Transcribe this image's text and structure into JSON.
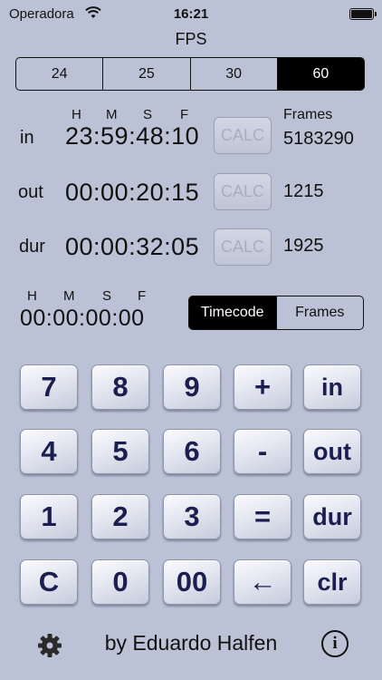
{
  "status": {
    "carrier": "Operadora",
    "time": "16:21"
  },
  "fps": {
    "title": "FPS",
    "options": [
      "24",
      "25",
      "30",
      "60"
    ],
    "selected": "60"
  },
  "headers": {
    "h": "H",
    "m": "M",
    "s": "S",
    "f": "F",
    "frames": "Frames"
  },
  "rows": [
    {
      "label": "in",
      "timecode": "23:59:48:10",
      "calc": "CALC",
      "frames": "5183290"
    },
    {
      "label": "out",
      "timecode": "00:00:20:15",
      "calc": "CALC",
      "frames": "1215"
    },
    {
      "label": "dur",
      "timecode": "00:00:32:05",
      "calc": "CALC",
      "frames": "1925"
    }
  ],
  "result": {
    "timecode": "00:00:00:00"
  },
  "mode": {
    "options": [
      "Timecode",
      "Frames"
    ],
    "selected": "Timecode"
  },
  "keypad": {
    "rows": [
      [
        "7",
        "8",
        "9",
        "+",
        "in"
      ],
      [
        "4",
        "5",
        "6",
        "-",
        "out"
      ],
      [
        "1",
        "2",
        "3",
        "=",
        "dur"
      ],
      [
        "C",
        "0",
        "00",
        "←",
        "clr"
      ]
    ]
  },
  "footer": {
    "credit": "by Eduardo Halfen",
    "settings_icon": "gear-icon",
    "info_icon": "info-icon",
    "info_glyph": "i"
  }
}
